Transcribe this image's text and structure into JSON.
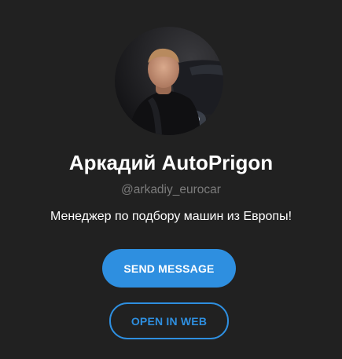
{
  "profile": {
    "display_name": "Аркадий AutoPrigon",
    "username": "@arkadiy_eurocar",
    "bio": "Менеджер по подбору машин из Европы!",
    "avatar_icon": "profile-photo"
  },
  "actions": {
    "send_message_label": "SEND MESSAGE",
    "open_in_web_label": "OPEN IN WEB"
  },
  "colors": {
    "background": "#212121",
    "accent": "#2e8fe0",
    "username_text": "#7c7c7c",
    "primary_text": "#ffffff"
  }
}
